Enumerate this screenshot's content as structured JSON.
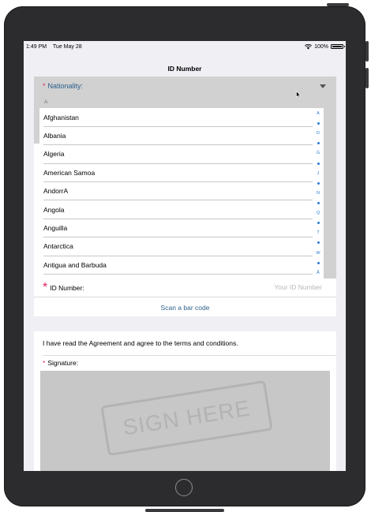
{
  "status_bar": {
    "time": "1:49 PM",
    "date": "Tue May 28",
    "battery": "100%"
  },
  "nav": {
    "title": "ID Number"
  },
  "nationality": {
    "label": "Nationality:",
    "required_mark": "*",
    "section_header": "A",
    "countries": [
      "Afghanistan",
      "Albania",
      "Algeria",
      "American Samoa",
      "AndorrA",
      "Angola",
      "Anguilla",
      "Antarctica",
      "Antigua and Barbuda"
    ],
    "index_letters": [
      "A",
      "D",
      "G",
      "J",
      "N",
      "Q",
      "T",
      "W",
      "Å"
    ]
  },
  "id_number": {
    "required_mark": "*",
    "label": "ID Number:",
    "placeholder": "Your ID Number",
    "value": ""
  },
  "scan": {
    "label": "Scan a bar code"
  },
  "agreement": {
    "text": "I have read the Agreement and agree to the terms and conditions."
  },
  "signature": {
    "required_mark": "*",
    "label": "Signature:",
    "watermark": "SIGN HERE"
  },
  "colors": {
    "accent": "#2b5f8a",
    "required": "#e0245e",
    "index": "#2a7ad8",
    "background": "#efeff4"
  }
}
